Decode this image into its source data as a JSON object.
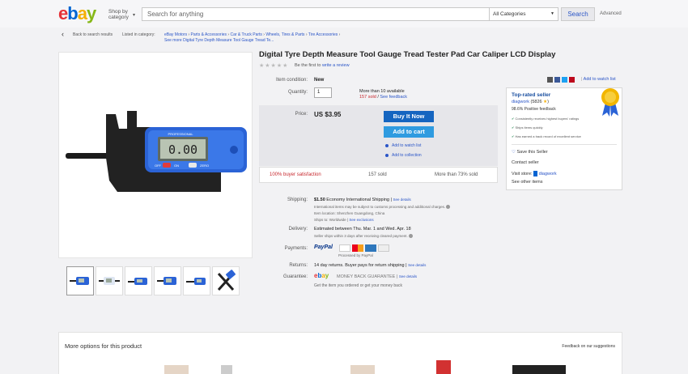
{
  "header": {
    "logo": [
      "e",
      "b",
      "a",
      "y"
    ],
    "shop_by_line1": "Shop by",
    "shop_by_line2": "category",
    "search_placeholder": "Search for anything",
    "category": "All Categories",
    "search_button": "Search",
    "advanced": "Advanced"
  },
  "breadcrumb": {
    "back": "Back to search results",
    "listed_in": "Listed in category:",
    "items": [
      "eBay Motors",
      "Parts & Accessories",
      "Car & Truck Parts",
      "Wheels, Tires & Parts",
      "Tire Accessories"
    ],
    "line2": "See more Digital Tyre Depth Measure Tool Gauge Tread Te..."
  },
  "product": {
    "title": "Digital Tyre Depth Measure Tool Gauge Tread Tester Pad Car Caliper LCD Display",
    "stars": "★★★★★",
    "review_prefix": "Be the first to",
    "review_link": "write a review",
    "gauge_reading": "0.00",
    "gauge_brand": "PROFESSIONAL",
    "gauge_off": "OFF",
    "gauge_on": "ON",
    "gauge_zero": "ZERO"
  },
  "details": {
    "condition_label": "Item condition:",
    "condition": "New",
    "quantity_label": "Quantity:",
    "quantity": "1",
    "available": "More than 10 available",
    "sold": "157 sold",
    "sold_sep": " / ",
    "see_feedback": "See feedback",
    "price_label": "Price:",
    "price": "US $3.95",
    "buy_now": "Buy It Now",
    "add_to_cart": "Add to cart",
    "add_watch": "Add to watch list",
    "add_collection": "Add to collection",
    "satisfaction": "100% buyer satisfaction",
    "sold_count": "157 sold",
    "watching": "More than 73% sold",
    "add_watch_top": "Add to watch list",
    "shipping_label": "Shipping:",
    "shipping_price": "$1.50",
    "shipping_method": "Economy International Shipping",
    "see_details": "See details",
    "intl_note": "International items may be subject to customs processing and additional charges.",
    "item_location": "Item location:  Shenzhen Guangdong, China",
    "ships_to": "Ships to:  Worldwide",
    "see_exclusions": "See exclusions",
    "delivery_label": "Delivery:",
    "delivery": "Estimated between Thu. Mar. 1 and Wed. Apr. 18",
    "delivery_note": "Seller ships within 3 days after receiving cleared payment.",
    "payments_label": "Payments:",
    "paypal": "PayPal",
    "processed_by": "Processed by PayPal",
    "returns_label": "Returns:",
    "returns": "14 day returns. Buyer pays for return shipping",
    "returns_details": "See details",
    "guarantee_label": "Guarantee:",
    "guarantee_text": "MONEY BACK GUARANTEE",
    "guarantee_details": "See details",
    "guarantee_note": "Get the item you ordered or get your money back"
  },
  "seller": {
    "top_rated": "Top-rated seller",
    "name": "diagwork",
    "rating": "(5826",
    "positive": "98.6% Positive feedback",
    "bullets": [
      "Consistently receives highest buyers' ratings",
      "Ships items quickly",
      "Has earned a track record of excellent service"
    ],
    "save": "Save this Seller",
    "contact": "Contact seller",
    "visit_store": "Visit store:",
    "store_name": "diagwork",
    "see_other": "See other items"
  },
  "more": {
    "title": "More options for this product",
    "feedback": "Feedback on our suggestions"
  },
  "colors": {
    "ebay_e": "#e53238",
    "ebay_b": "#0064d2",
    "ebay_a": "#f5af02",
    "ebay_y": "#86b817",
    "link": "#2a55c7",
    "buy": "#1565c0",
    "cart": "#2f9be0"
  }
}
